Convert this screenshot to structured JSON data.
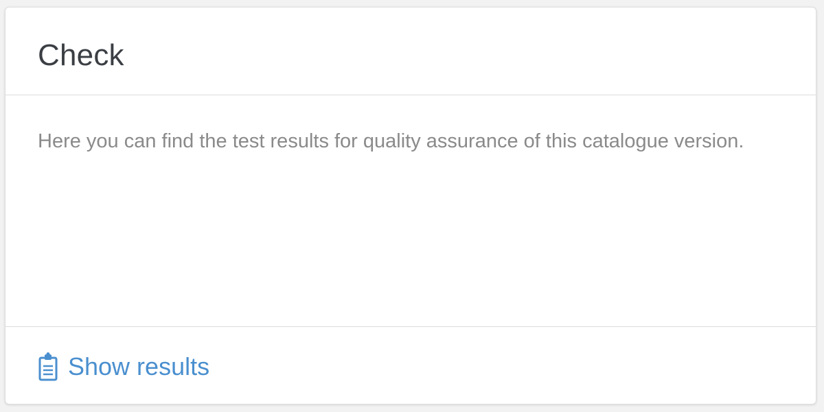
{
  "card": {
    "title": "Check",
    "description": "Here you can find the test results for quality assurance of this catalogue version.",
    "footer": {
      "link_label": "Show results",
      "link_icon": "clipboard-icon"
    }
  },
  "colors": {
    "accent": "#4a8fcf",
    "title": "#3b3f44",
    "body_text": "#8a8a8a",
    "divider": "#dcdcdc"
  }
}
